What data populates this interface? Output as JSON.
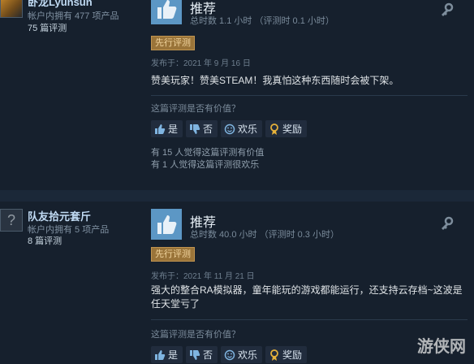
{
  "reviews": [
    {
      "user": {
        "name": "卧龙Lyunsun",
        "products": "帐户内拥有 477 项产品",
        "review_count": "75 篇评测"
      },
      "verdict": "推荐",
      "hours": "总时数 1.1 小时 （评测时 0.1 小时）",
      "early_access": "先行评测",
      "posted": "发布于：2021 年 9 月 16 日",
      "content": "赞美玩家！赞美STEAM！我真怕这种东西随时会被下架。",
      "helpful_prompt": "这篇评测是否有价值？",
      "buttons": {
        "yes": "是",
        "no": "否",
        "funny": "欢乐",
        "award": "奖励"
      },
      "stats": [
        "有 15 人觉得这篇评测有价值",
        "有 1 人觉得这篇评测很欢乐"
      ]
    },
    {
      "user": {
        "name": "队友拾元套斤",
        "products": "帐户内拥有 5 项产品",
        "review_count": "8 篇评测",
        "avatar_glyph": "?"
      },
      "verdict": "推荐",
      "hours": "总时数 40.0 小时 （评测时 0.3 小时）",
      "early_access": "先行评测",
      "posted": "发布于：2021 年 11 月 21 日",
      "content": "强大的整合RA模拟器，童年能玩的游戏都能运行，还支持云存档~这波是任天堂亏了",
      "helpful_prompt": "这篇评测是否有价值？",
      "buttons": {
        "yes": "是",
        "no": "否",
        "funny": "欢乐",
        "award": "奖励"
      }
    }
  ],
  "watermark": "游侠网"
}
